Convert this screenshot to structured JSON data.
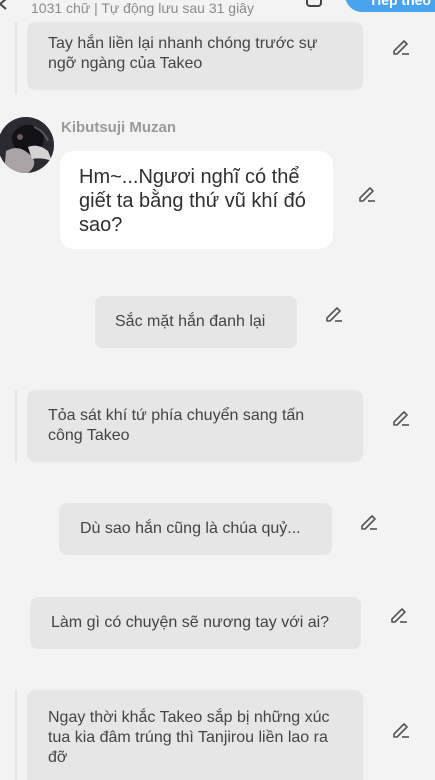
{
  "header": {
    "status_text": "1031 chữ | Tự động lưu sau 31 giây",
    "next_label": "Tiếp theo",
    "accent_color": "#4aa3ef"
  },
  "messages": [
    {
      "type": "narration",
      "text": "Tay hắn liền lại nhanh chóng trước sự ngỡ ngàng của Takeo"
    },
    {
      "type": "character",
      "name": "Kibutsuji Muzan",
      "text": "Hm~...Ngươi nghĩ có thể giết ta bằng thứ vũ khí đó sao?"
    },
    {
      "type": "narration",
      "text": "Sắc mặt hắn đanh lại"
    },
    {
      "type": "narration",
      "text": "Tỏa sát khí tứ phía chuyển sang tấn công Takeo"
    },
    {
      "type": "narration",
      "text": "Dù sao hắn cũng là chúa quỷ..."
    },
    {
      "type": "narration",
      "text": "Làm gì có chuyện sẽ nương tay với ai?"
    },
    {
      "type": "narration",
      "text": "Ngay thời khắc Takeo sắp bị những xúc tua kia đâm trúng thì Tanjirou liền lao ra đỡ"
    }
  ],
  "icons": {
    "back": "back-arrow-icon",
    "square": "square-icon",
    "edit": "pencil-icon",
    "avatar": "character-avatar"
  }
}
